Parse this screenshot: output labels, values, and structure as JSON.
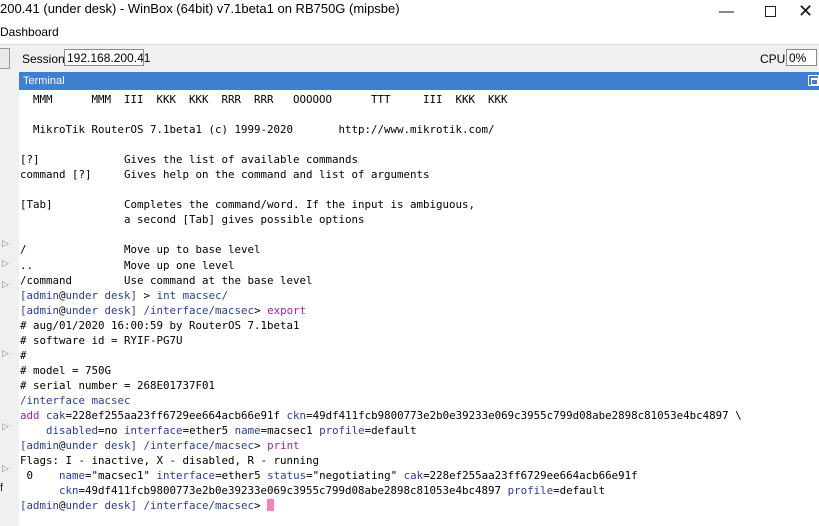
{
  "window": {
    "title": "200.41 (under desk) - WinBox (64bit) v7.1beta1 on RB750G (mipsbe)",
    "minimize_glyph": "—",
    "close_glyph": "✕"
  },
  "menubar": {
    "items": [
      "Dashboard"
    ]
  },
  "toolbar": {
    "session_label": "Session:",
    "session_value": "192.168.200.41",
    "cpu_label": "CPU:",
    "cpu_value": "0%"
  },
  "left_strip": {
    "arrow_glyph": "▷",
    "partial_text": "f"
  },
  "terminal": {
    "title": "Terminal",
    "lines": [
      [
        {
          "t": "  MMM      MMM  III  KKK  KKK  RRR  RRR   OOOOOO      TTT     III  KKK  KKK"
        }
      ],
      [
        {
          "t": ""
        }
      ],
      [
        {
          "t": "  MikroTik RouterOS 7.1beta1 (c) 1999-2020       http://www.mikrotik.com/"
        }
      ],
      [
        {
          "t": ""
        }
      ],
      [
        {
          "t": "[?]             Gives the list of available commands"
        }
      ],
      [
        {
          "t": "command [?]     Gives help on the command and list of arguments"
        }
      ],
      [
        {
          "t": ""
        }
      ],
      [
        {
          "t": "[Tab]           Completes the command/word. If the input is ambiguous,"
        }
      ],
      [
        {
          "t": "                a second [Tab] gives possible options"
        }
      ],
      [
        {
          "t": ""
        }
      ],
      [
        {
          "t": "/               Move up to base level"
        }
      ],
      [
        {
          "t": "..              Move up one level"
        }
      ],
      [
        {
          "t": "/command        Use command at the base level"
        }
      ],
      [
        {
          "t": "[admin",
          "c": "blue"
        },
        {
          "t": "@"
        },
        {
          "t": "under desk] ",
          "c": "blue"
        },
        {
          "t": "> "
        },
        {
          "t": "int macsec/",
          "c": "blue"
        }
      ],
      [
        {
          "t": "[admin",
          "c": "blue"
        },
        {
          "t": "@"
        },
        {
          "t": "under desk] ",
          "c": "blue"
        },
        {
          "t": "/interface/macsec",
          "c": "blue"
        },
        {
          "t": "> "
        },
        {
          "t": "export",
          "c": "purple"
        }
      ],
      [
        {
          "t": "# aug/01/2020 16:00:59 by RouterOS 7.1beta1"
        }
      ],
      [
        {
          "t": "# software id = RYIF-PG7U"
        }
      ],
      [
        {
          "t": "#"
        }
      ],
      [
        {
          "t": "# model = 750G"
        }
      ],
      [
        {
          "t": "# serial number = 268E01737F01"
        }
      ],
      [
        {
          "t": "/interface macsec",
          "c": "blue"
        }
      ],
      [
        {
          "t": "add ",
          "c": "purple"
        },
        {
          "t": "cak",
          "c": "blue"
        },
        {
          "t": "=228ef255aa23ff6729ee664acb66e91f "
        },
        {
          "t": "ckn",
          "c": "blue"
        },
        {
          "t": "=49df411fcb9800773e2b0e39233e069c3955c799d08abe2898c81053e4bc4897 \\"
        }
      ],
      [
        {
          "t": "    "
        },
        {
          "t": "disabled",
          "c": "blue"
        },
        {
          "t": "=no "
        },
        {
          "t": "interface",
          "c": "blue"
        },
        {
          "t": "=ether5 "
        },
        {
          "t": "name",
          "c": "blue"
        },
        {
          "t": "=macsec1 "
        },
        {
          "t": "profile",
          "c": "blue"
        },
        {
          "t": "=default"
        }
      ],
      [
        {
          "t": "[admin",
          "c": "blue"
        },
        {
          "t": "@"
        },
        {
          "t": "under desk] ",
          "c": "blue"
        },
        {
          "t": "/interface/macsec",
          "c": "blue"
        },
        {
          "t": "> "
        },
        {
          "t": "print",
          "c": "purple"
        }
      ],
      [
        {
          "t": "Flags: I - inactive, X - disabled, R - running"
        }
      ],
      [
        {
          "t": " 0    "
        },
        {
          "t": "name",
          "c": "blue"
        },
        {
          "t": "=\"macsec1\" "
        },
        {
          "t": "interface",
          "c": "blue"
        },
        {
          "t": "=ether5 "
        },
        {
          "t": "status",
          "c": "blue"
        },
        {
          "t": "=\"negotiating\" "
        },
        {
          "t": "cak",
          "c": "blue"
        },
        {
          "t": "=228ef255aa23ff6729ee664acb66e91f"
        }
      ],
      [
        {
          "t": "      "
        },
        {
          "t": "ckn",
          "c": "blue"
        },
        {
          "t": "=49df411fcb9800773e2b0e39233e069c3955c799d08abe2898c81053e4bc4897 "
        },
        {
          "t": "profile",
          "c": "blue"
        },
        {
          "t": "=default"
        }
      ],
      [
        {
          "t": "[admin",
          "c": "blue"
        },
        {
          "t": "@"
        },
        {
          "t": "under desk] ",
          "c": "blue"
        },
        {
          "t": "/interface/macsec",
          "c": "blue"
        },
        {
          "t": "> "
        },
        {
          "cursor": true
        }
      ]
    ]
  }
}
